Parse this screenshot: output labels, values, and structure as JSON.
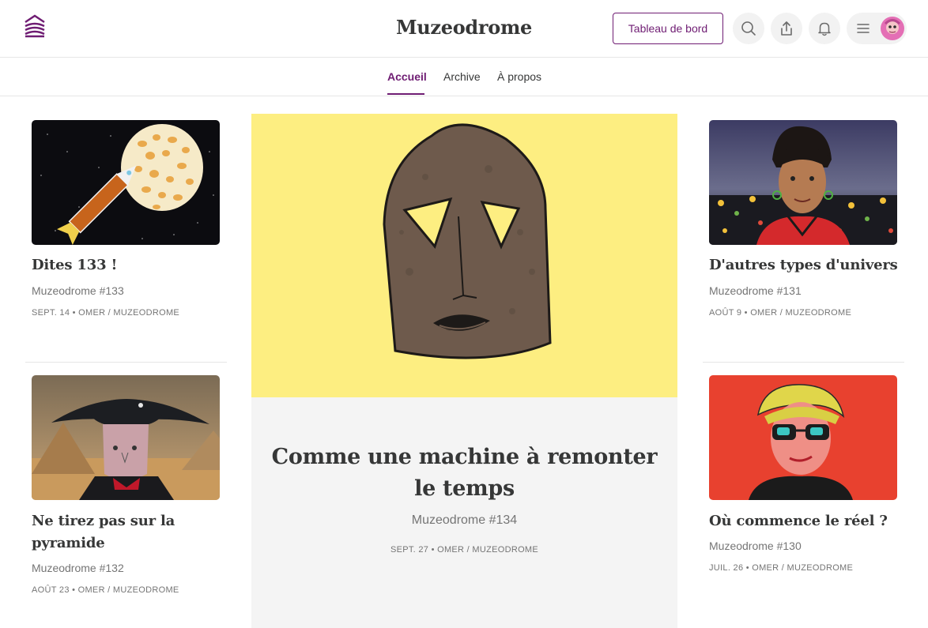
{
  "header": {
    "site_title": "Muzeodrome",
    "logo_text": "muzeodrome",
    "dashboard_label": "Tableau de bord",
    "icons": [
      "search-icon",
      "share-icon",
      "bell-icon",
      "menu-icon",
      "avatar"
    ]
  },
  "nav": {
    "tabs": [
      {
        "label": "Accueil",
        "active": true
      },
      {
        "label": "Archive",
        "active": false
      },
      {
        "label": "À propos",
        "active": false
      }
    ]
  },
  "posts": {
    "left": [
      {
        "title": "Dites 133 !",
        "subtitle": "Muzeodrome #133",
        "meta": "SEPT. 14 • OMER / MUZEODROME"
      },
      {
        "title": "Ne tirez pas sur la pyramide",
        "subtitle": "Muzeodrome #132",
        "meta": "AOÛT 23 • OMER / MUZEODROME"
      }
    ],
    "featured": {
      "title": "Comme une machine à remonter le temps",
      "subtitle": "Muzeodrome #134",
      "meta": "SEPT. 27 • OMER / MUZEODROME"
    },
    "right": [
      {
        "title": "D'autres types d'univers",
        "subtitle": "Muzeodrome #131",
        "meta": "AOÛT 9 • OMER / MUZEODROME"
      },
      {
        "title": "Où commence le réel ?",
        "subtitle": "Muzeodrome #130",
        "meta": "JUIL. 26 • OMER / MUZEODROME"
      }
    ]
  },
  "colors": {
    "accent": "#6f1d73",
    "text": "#363737",
    "muted": "#757575",
    "hero_background": "#fdee81",
    "featured_background": "#f4f4f4"
  }
}
